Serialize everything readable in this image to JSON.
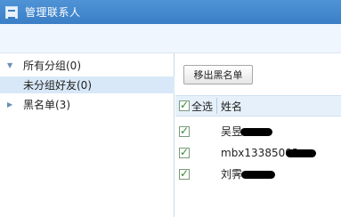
{
  "window": {
    "title": "管理联系人",
    "icon": "contacts-app-icon"
  },
  "sidebar": {
    "items": [
      {
        "caret": "▼",
        "label": "所有分组(0)",
        "selected": false
      },
      {
        "caret": "",
        "label": "未分组好友(0)",
        "selected": true
      },
      {
        "caret": "▶",
        "label": "黑名单(3)",
        "selected": false
      }
    ]
  },
  "main": {
    "remove_button_label": "移出黑名单",
    "header": {
      "select_all_label": "全选",
      "name_column_label": "姓名"
    },
    "rows": [
      {
        "checked": true,
        "name": "吴昱"
      },
      {
        "checked": true,
        "name": "mbx13385003"
      },
      {
        "checked": true,
        "name": "刘霁"
      }
    ]
  }
}
